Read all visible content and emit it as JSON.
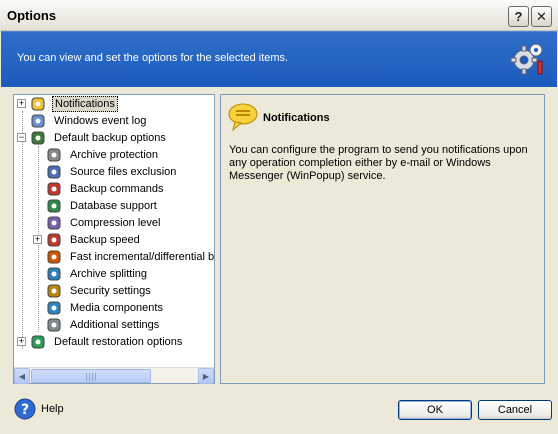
{
  "window": {
    "title": "Options",
    "help_glyph": "?",
    "close_glyph": "✕"
  },
  "banner": {
    "text": "You can view and set the options for the selected items."
  },
  "tree": {
    "items": [
      {
        "label": "Notifications",
        "level": 0,
        "expander": "+",
        "icon": "notifications-icon",
        "selected": true
      },
      {
        "label": "Windows event log",
        "level": 0,
        "expander": "",
        "icon": "event-log-icon"
      },
      {
        "label": "Default backup options",
        "level": 0,
        "expander": "−",
        "icon": "backup-options-icon"
      },
      {
        "label": "Archive protection",
        "level": 1,
        "expander": "",
        "icon": "lock-icon"
      },
      {
        "label": "Source files exclusion",
        "level": 1,
        "expander": "",
        "icon": "filter-icon"
      },
      {
        "label": "Backup commands",
        "level": 1,
        "expander": "",
        "icon": "commands-icon"
      },
      {
        "label": "Database support",
        "level": 1,
        "expander": "",
        "icon": "database-icon"
      },
      {
        "label": "Compression level",
        "level": 1,
        "expander": "",
        "icon": "compression-icon"
      },
      {
        "label": "Backup speed",
        "level": 1,
        "expander": "+",
        "icon": "speed-icon"
      },
      {
        "label": "Fast incremental/differential ba",
        "level": 1,
        "expander": "",
        "icon": "incremental-icon"
      },
      {
        "label": "Archive splitting",
        "level": 1,
        "expander": "",
        "icon": "splitting-icon"
      },
      {
        "label": "Security settings",
        "level": 1,
        "expander": "",
        "icon": "security-icon"
      },
      {
        "label": "Media components",
        "level": 1,
        "expander": "",
        "icon": "media-icon"
      },
      {
        "label": "Additional settings",
        "level": 1,
        "expander": "",
        "icon": "settings-icon"
      },
      {
        "label": "Default restoration options",
        "level": 0,
        "expander": "+",
        "icon": "restore-options-icon"
      }
    ]
  },
  "info": {
    "title": "Notifications",
    "description": "You can configure the program to send you notifications upon any operation completion either by e-mail or Windows Messenger (WinPopup) service."
  },
  "footer": {
    "help_label": "Help",
    "ok_label": "OK",
    "cancel_label": "Cancel"
  }
}
